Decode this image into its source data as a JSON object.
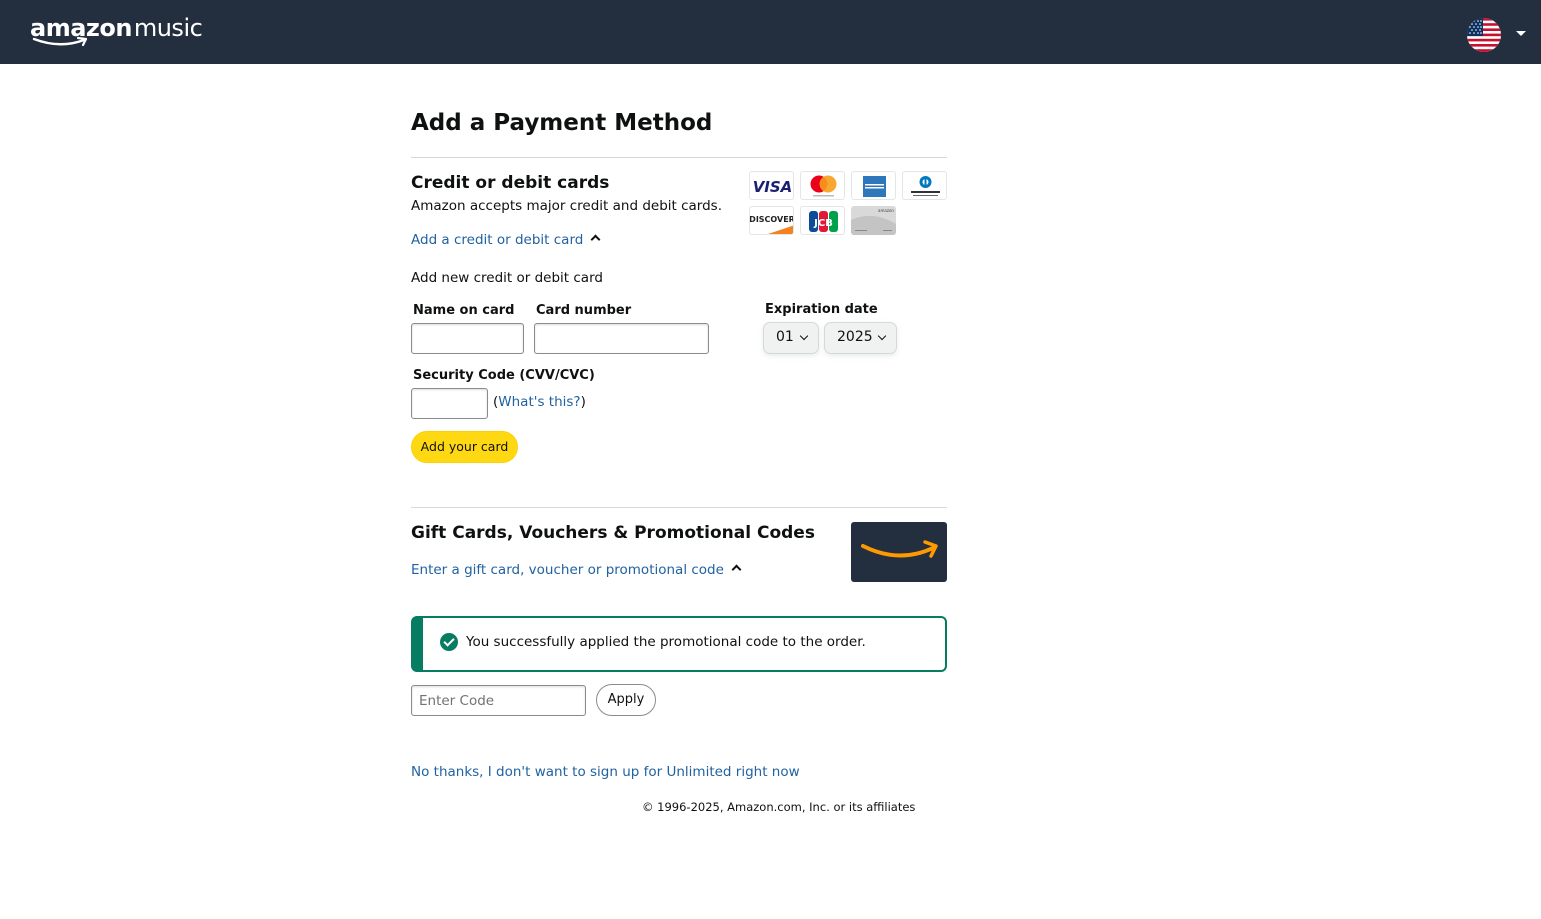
{
  "header": {
    "brand_prefix": "amazon",
    "brand_suffix": "music",
    "locale_icon": "us-flag-icon"
  },
  "page": {
    "title": "Add a Payment Method"
  },
  "cards_section": {
    "title": "Credit or debit cards",
    "description": "Amazon accepts major credit and debit cards.",
    "toggle_link": "Add a credit or debit card",
    "subheading": "Add new credit or debit card",
    "logos": [
      "VISA",
      "Mastercard",
      "American Express",
      "Diners Club",
      "DISCOVER",
      "JCB",
      "amazon"
    ],
    "name_label": "Name on card",
    "name_value": "",
    "number_label": "Card number",
    "number_value": "",
    "expiration_label": "Expiration date",
    "exp_month": "01",
    "exp_year": "2025",
    "security_label": "Security Code (CVV/CVC)",
    "security_value": "",
    "whats_this_open": "(",
    "whats_this_link": "What's this?",
    "whats_this_close": ")",
    "add_button": "Add your card"
  },
  "gift_section": {
    "title": "Gift Cards, Vouchers & Promotional Codes",
    "toggle_link": "Enter a gift card, voucher or promotional code",
    "success_message": "You successfully applied the promotional code to the order.",
    "code_placeholder": "Enter Code",
    "code_value": "",
    "apply_button": "Apply"
  },
  "decline_link": "No thanks, I don't want to sign up for Unlimited right now",
  "footer": {
    "copyright": "© 1996-2025, Amazon.com, Inc. or its affiliates"
  },
  "colors": {
    "header_bg": "#232f3e",
    "link": "#2162a1",
    "primary_button": "#ffd814",
    "success": "#067d62",
    "amazon_orange": "#ff9900"
  }
}
